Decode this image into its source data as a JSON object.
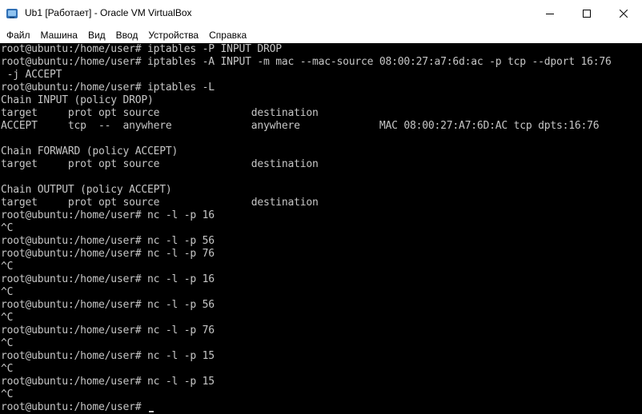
{
  "window": {
    "title": "Ub1 [Работает] - Oracle VM VirtualBox",
    "controls": [
      "minimize-icon",
      "maximize-icon",
      "close-icon"
    ]
  },
  "menu": {
    "items": [
      "Файл",
      "Машина",
      "Вид",
      "Ввод",
      "Устройства",
      "Справка"
    ]
  },
  "terminal": {
    "lines": [
      "root@ubuntu:/home/user# iptables -P INPUT DROP",
      "root@ubuntu:/home/user# iptables -A INPUT -m mac --mac-source 08:00:27:a7:6d:ac -p tcp --dport 16:76",
      " -j ACCEPT",
      "root@ubuntu:/home/user# iptables -L",
      "Chain INPUT (policy DROP)",
      "target     prot opt source               destination",
      "ACCEPT     tcp  --  anywhere             anywhere             MAC 08:00:27:A7:6D:AC tcp dpts:16:76",
      "",
      "Chain FORWARD (policy ACCEPT)",
      "target     prot opt source               destination",
      "",
      "Chain OUTPUT (policy ACCEPT)",
      "target     prot opt source               destination",
      "root@ubuntu:/home/user# nc -l -p 16",
      "^C",
      "root@ubuntu:/home/user# nc -l -p 56",
      "root@ubuntu:/home/user# nc -l -p 76",
      "^C",
      "root@ubuntu:/home/user# nc -l -p 16",
      "^C",
      "root@ubuntu:/home/user# nc -l -p 56",
      "^C",
      "root@ubuntu:/home/user# nc -l -p 76",
      "^C",
      "root@ubuntu:/home/user# nc -l -p 15",
      "^C",
      "root@ubuntu:/home/user# nc -l -p 15",
      "^C",
      "root@ubuntu:/home/user# "
    ]
  },
  "colors": {
    "terminal_bg": "#000000",
    "terminal_fg": "#c6c6c6"
  }
}
